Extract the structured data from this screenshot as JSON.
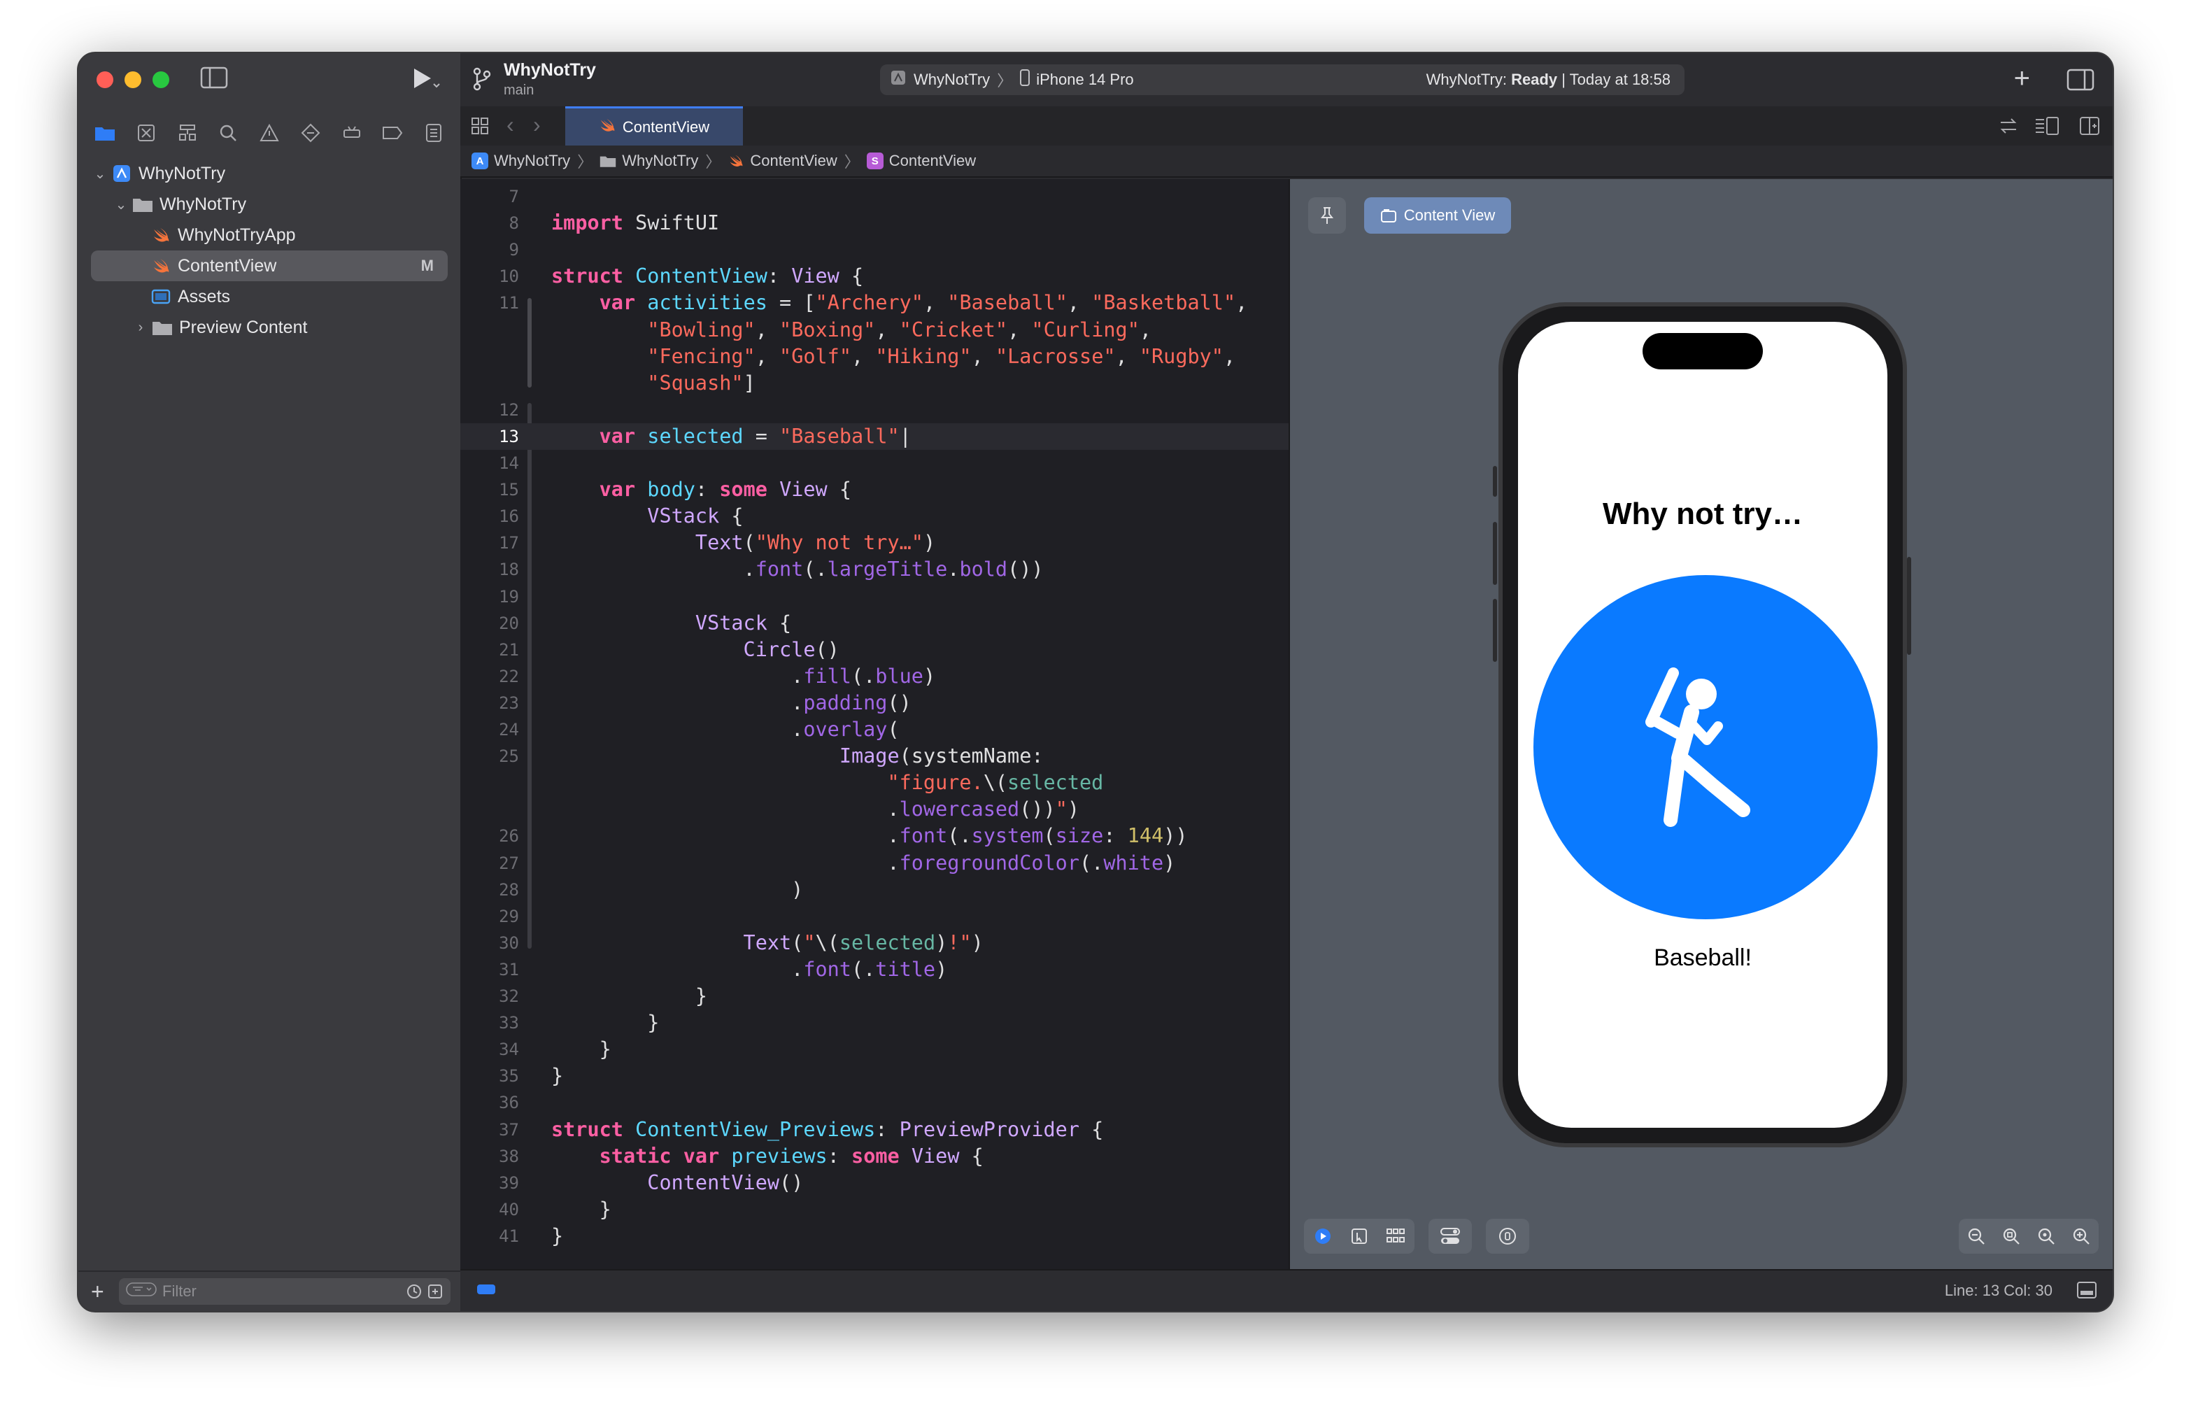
{
  "window": {
    "project_name": "WhyNotTry",
    "branch": "main"
  },
  "toolbar": {
    "scheme": "WhyNotTry",
    "device": "iPhone 14 Pro",
    "status_app": "WhyNotTry:",
    "status_state": "Ready",
    "status_time": "| Today at 18:58"
  },
  "navigator": {
    "root": "WhyNotTry",
    "group": "WhyNotTry",
    "items": [
      {
        "label": "WhyNotTryApp"
      },
      {
        "label": "ContentView",
        "badge": "M"
      },
      {
        "label": "Assets"
      },
      {
        "label": "Preview Content"
      }
    ],
    "filter_placeholder": "Filter"
  },
  "tabs": [
    {
      "label": "ContentView"
    }
  ],
  "breadcrumb": [
    "WhyNotTry",
    "WhyNotTry",
    "ContentView",
    "ContentView"
  ],
  "breadcrumb_icon_letter": "S",
  "code": {
    "current_line": 13,
    "lines": [
      {
        "n": "7",
        "html": ""
      },
      {
        "n": "8",
        "html": "<span class='kw'>import</span> SwiftUI"
      },
      {
        "n": "9",
        "html": ""
      },
      {
        "n": "10",
        "html": "<span class='kw'>struct</span> <span class='tn'>ContentView</span>: <span class='ty'>View</span> {"
      },
      {
        "n": "11",
        "html": "    <span class='kw'>var</span> <span class='tn'>activities</span> = [<span class='st'>\"Archery\"</span>, <span class='st'>\"Baseball\"</span>, <span class='st'>\"Basketball\"</span>,"
      },
      {
        "n": "",
        "html": "        <span class='st'>\"Bowling\"</span>, <span class='st'>\"Boxing\"</span>, <span class='st'>\"Cricket\"</span>, <span class='st'>\"Curling\"</span>,"
      },
      {
        "n": "",
        "html": "        <span class='st'>\"Fencing\"</span>, <span class='st'>\"Golf\"</span>, <span class='st'>\"Hiking\"</span>, <span class='st'>\"Lacrosse\"</span>, <span class='st'>\"Rugby\"</span>,"
      },
      {
        "n": "",
        "html": "        <span class='st'>\"Squash\"</span>]"
      },
      {
        "n": "12",
        "html": ""
      },
      {
        "n": "13",
        "html": "    <span class='kw'>var</span> <span class='tn'>selected</span> = <span class='st'>\"Baseball\"</span>|"
      },
      {
        "n": "14",
        "html": ""
      },
      {
        "n": "15",
        "html": "    <span class='kw'>var</span> <span class='tn'>body</span>: <span class='kw'>some</span> <span class='ty'>View</span> {"
      },
      {
        "n": "16",
        "html": "        <span class='ty'>VStack</span> {"
      },
      {
        "n": "17",
        "html": "            <span class='ty'>Text</span>(<span class='st'>\"Why not try…\"</span>)"
      },
      {
        "n": "18",
        "html": "                .<span class='pr'>font</span>(.<span class='pr'>largeTitle</span>.<span class='pr'>bold</span>())"
      },
      {
        "n": "19",
        "html": ""
      },
      {
        "n": "20",
        "html": "            <span class='ty'>VStack</span> {"
      },
      {
        "n": "21",
        "html": "                <span class='ty'>Circle</span>()"
      },
      {
        "n": "22",
        "html": "                    .<span class='pr'>fill</span>(.<span class='pr'>blue</span>)"
      },
      {
        "n": "23",
        "html": "                    .<span class='pr'>padding</span>()"
      },
      {
        "n": "24",
        "html": "                    .<span class='pr'>overlay</span>("
      },
      {
        "n": "25",
        "html": "                        <span class='ty'>Image</span>(systemName:"
      },
      {
        "n": "",
        "html": "                            <span class='st'>\"figure.</span>\\(<span class='fn'>selected</span>"
      },
      {
        "n": "",
        "html": "                            .<span class='pr'>lowercased</span>())<span class='st'>\"</span>)"
      },
      {
        "n": "26",
        "html": "                            .<span class='pr'>font</span>(.<span class='pr'>system</span>(<span class='pr'>size</span>: <span class='nm'>144</span>))"
      },
      {
        "n": "27",
        "html": "                            .<span class='pr'>foregroundColor</span>(.<span class='pr'>white</span>)"
      },
      {
        "n": "28",
        "html": "                    )"
      },
      {
        "n": "29",
        "html": ""
      },
      {
        "n": "30",
        "html": "                <span class='ty'>Text</span>(<span class='st'>\"</span>\\(<span class='fn'>selected</span>)<span class='st'>!\"</span>)"
      },
      {
        "n": "31",
        "html": "                    .<span class='pr'>font</span>(.<span class='pr'>title</span>)"
      },
      {
        "n": "32",
        "html": "            }"
      },
      {
        "n": "33",
        "html": "        }"
      },
      {
        "n": "34",
        "html": "    }"
      },
      {
        "n": "35",
        "html": "}"
      },
      {
        "n": "36",
        "html": ""
      },
      {
        "n": "37",
        "html": "<span class='kw'>struct</span> <span class='tn'>ContentView_Previews</span>: <span class='ty'>PreviewProvider</span> {"
      },
      {
        "n": "38",
        "html": "    <span class='kw'>static</span> <span class='kw'>var</span> <span class='tn'>previews</span>: <span class='kw'>some</span> <span class='ty'>View</span> {"
      },
      {
        "n": "39",
        "html": "        <span class='ty'>ContentView</span>()"
      },
      {
        "n": "40",
        "html": "    }"
      },
      {
        "n": "41",
        "html": "}"
      }
    ]
  },
  "preview": {
    "button_label": "Content View",
    "title": "Why not try…",
    "sport_label": "Baseball!",
    "circle_color": "#0A7AFF"
  },
  "statusbar": {
    "cursor": "Line: 13  Col: 30"
  },
  "colors": {
    "accent": "#3F7EF6",
    "editor_bg": "#1F1F24",
    "canvas_bg": "#535962"
  }
}
